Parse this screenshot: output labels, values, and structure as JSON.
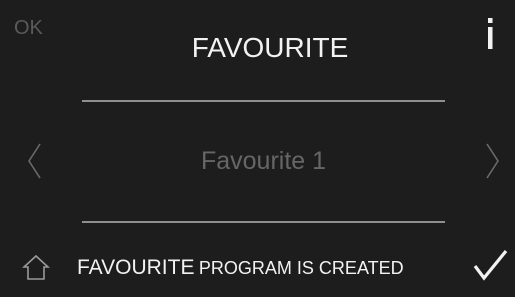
{
  "header": {
    "ok_label": "OK",
    "title": "FAVOURITE",
    "info_label": "i"
  },
  "selector": {
    "current_item": "Favourite 1"
  },
  "footer": {
    "status_word": "FAVOURITE",
    "status_rest": "PROGRAM IS CREATED"
  },
  "icons": {
    "info": "info-icon",
    "prev": "chevron-left-icon",
    "next": "chevron-right-icon",
    "home": "home-icon",
    "confirm": "checkmark-icon"
  },
  "colors": {
    "background": "#1e1d1d",
    "text": "#f2f2f2",
    "dim_text": "#5a5a5a",
    "divider": "#8f8f8f"
  }
}
